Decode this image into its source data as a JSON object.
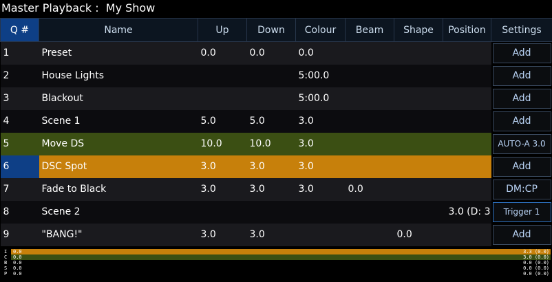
{
  "title": "Master Playback :  My Show",
  "columns": [
    "Q #",
    "Name",
    "Up",
    "Down",
    "Colour",
    "Beam",
    "Shape",
    "Position",
    "Settings"
  ],
  "cues": [
    {
      "q": "1",
      "name": "Preset",
      "up": "0.0",
      "down": "0.0",
      "colour": "0.0",
      "beam": "",
      "shape": "",
      "position": "",
      "settings": "Add",
      "state": "odd"
    },
    {
      "q": "2",
      "name": "House Lights",
      "up": "",
      "down": "",
      "colour": "5:00.0",
      "beam": "",
      "shape": "",
      "position": "",
      "settings": "Add",
      "state": "even"
    },
    {
      "q": "3",
      "name": "Blackout",
      "up": "",
      "down": "",
      "colour": "5:00.0",
      "beam": "",
      "shape": "",
      "position": "",
      "settings": "Add",
      "state": "odd"
    },
    {
      "q": "4",
      "name": "Scene 1",
      "up": "5.0",
      "down": "5.0",
      "colour": "3.0",
      "beam": "",
      "shape": "",
      "position": "",
      "settings": "Add",
      "state": "even"
    },
    {
      "q": "5",
      "name": "Move DS",
      "up": "10.0",
      "down": "10.0",
      "colour": "3.0",
      "beam": "",
      "shape": "",
      "position": "",
      "settings": "AUTO-A 3.0",
      "state": "next"
    },
    {
      "q": "6",
      "name": "DSC Spot",
      "up": "3.0",
      "down": "3.0",
      "colour": "3.0",
      "beam": "",
      "shape": "",
      "position": "",
      "settings": "Add",
      "state": "live"
    },
    {
      "q": "7",
      "name": "Fade to Black",
      "up": "3.0",
      "down": "3.0",
      "colour": "3.0",
      "beam": "0.0",
      "shape": "",
      "position": "",
      "settings": "DM:CP",
      "state": "odd"
    },
    {
      "q": "8",
      "name": "Scene 2",
      "up": "",
      "down": "",
      "colour": "",
      "beam": "",
      "shape": "",
      "position": "3.0 (D: 3",
      "settings": "Trigger 1",
      "state": "even"
    },
    {
      "q": "9",
      "name": "\"BANG!\"",
      "up": "3.0",
      "down": "3.0",
      "colour": "",
      "beam": "",
      "shape": "0.0",
      "position": "",
      "settings": "Add",
      "state": "odd"
    }
  ],
  "status_lines": [
    {
      "label": "I",
      "left": "0.0",
      "right": "3.3 (0.0)",
      "color": "#c7800b",
      "progress": 1.0
    },
    {
      "label": "C",
      "left": "0.0",
      "right": "3.0 (0.0)",
      "color": "#3b4f13",
      "progress": 1.0
    },
    {
      "label": "B",
      "left": "0.0",
      "right": "0.0 (0.0)",
      "color": "#000000",
      "progress": 0.0
    },
    {
      "label": "S",
      "left": "0.0",
      "right": "0.0 (0.0)",
      "color": "#000000",
      "progress": 0.0
    },
    {
      "label": "P",
      "left": "0.0",
      "right": "0.0 (0.0)",
      "color": "#000000",
      "progress": 0.0
    }
  ]
}
